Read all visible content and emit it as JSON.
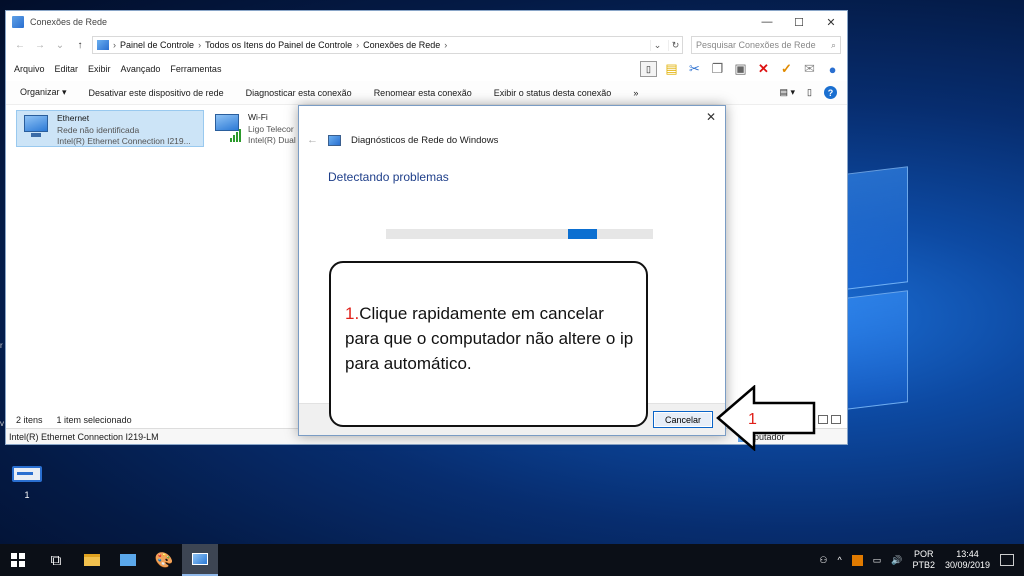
{
  "explorer": {
    "title": "Conexões de Rede",
    "breadcrumb": [
      "Painel de Controle",
      "Todos os Itens do Painel de Controle",
      "Conexões de Rede"
    ],
    "search_placeholder": "Pesquisar Conexões de Rede",
    "menu": [
      "Arquivo",
      "Editar",
      "Exibir",
      "Avançado",
      "Ferramentas"
    ],
    "commands": [
      "Organizar ▾",
      "Desativar este dispositivo de rede",
      "Diagnosticar esta conexão",
      "Renomear esta conexão",
      "Exibir o status desta conexão",
      "»"
    ],
    "items": [
      {
        "name": "Ethernet",
        "status": "Rede não identificada",
        "device": "Intel(R) Ethernet Connection I219..."
      },
      {
        "name": "Wi-Fi",
        "status": "Ligo Telecor",
        "device": "Intel(R) Dual"
      }
    ],
    "status": {
      "count": "2 itens",
      "selected": "1 item selecionado"
    },
    "details": "Intel(R) Ethernet Connection I219-LM",
    "fragment": "putador"
  },
  "dialog": {
    "title": "Diagnósticos de Rede do Windows",
    "heading": "Detectando problemas",
    "progress": {
      "start": 0.68,
      "width": 0.11
    },
    "cancel": "Cancelar"
  },
  "annotation": {
    "num": "1.",
    "text": "Clique rapidamente em cancelar para que o computador não altere o ip para automático.",
    "arrow_label": "1",
    "accent": "#e0201a"
  },
  "desktop": {
    "icon_label": "1",
    "edge_r": "r",
    "edge_v": "v"
  },
  "taskbar": {
    "lang": "POR",
    "layout": "PTB2",
    "time": "13:44",
    "date": "30/09/2019"
  }
}
